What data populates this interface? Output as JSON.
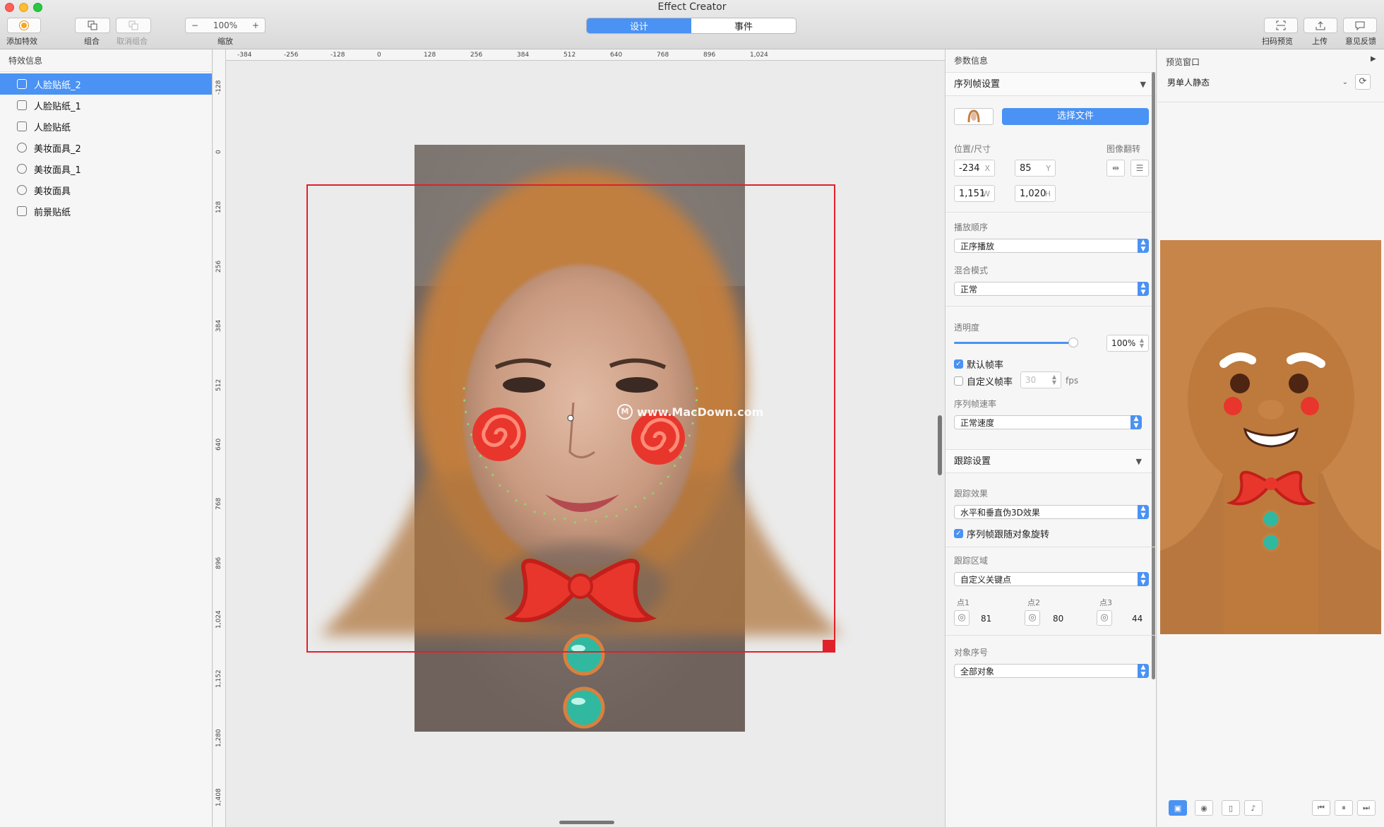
{
  "window": {
    "title": "Effect Creator"
  },
  "toolbar": {
    "add_effect": "添加特效",
    "group": "组合",
    "ungroup": "取消组合",
    "zoom_value": "100%",
    "zoom_minus": "−",
    "zoom_plus": "+",
    "zoom_label": "缩放",
    "tabs": [
      {
        "label": "设计",
        "active": true
      },
      {
        "label": "事件",
        "active": false
      }
    ],
    "scan_preview": "扫码预览",
    "upload": "上传",
    "feedback": "意见反馈"
  },
  "layers": {
    "header": "特效信息",
    "items": [
      {
        "label": "人脸贴纸_2",
        "selected": true,
        "icon": "sticker-icon"
      },
      {
        "label": "人脸贴纸_1",
        "selected": false,
        "icon": "sticker-icon"
      },
      {
        "label": "人脸贴纸",
        "selected": false,
        "icon": "sticker-icon"
      },
      {
        "label": "美妆面具_2",
        "selected": false,
        "icon": "mask-icon"
      },
      {
        "label": "美妆面具_1",
        "selected": false,
        "icon": "mask-icon"
      },
      {
        "label": "美妆面具",
        "selected": false,
        "icon": "mask-icon"
      },
      {
        "label": "前景贴纸",
        "selected": false,
        "icon": "sticker-icon"
      }
    ]
  },
  "canvas": {
    "ruler_h": [
      "-384",
      "-256",
      "-128",
      "0",
      "128",
      "256",
      "384",
      "512",
      "640",
      "768",
      "896",
      "1,024"
    ],
    "ruler_v": [
      "-128",
      "0",
      "128",
      "256",
      "384",
      "512",
      "640",
      "768",
      "896",
      "1,024",
      "1,152",
      "1,280",
      "1,408"
    ],
    "watermark": "www.MacDown.com"
  },
  "params": {
    "header": "参数信息",
    "sequence_section": "序列帧设置",
    "choose_file": "选择文件",
    "pos_size_label": "位置/尺寸",
    "flip_label": "图像翻转",
    "x": "-234",
    "x_suffix": "X",
    "y": "85",
    "y_suffix": "Y",
    "w": "1,151",
    "w_suffix": "W",
    "h": "1,020",
    "h_suffix": "H",
    "play_order_label": "播放顺序",
    "play_order": "正序播放",
    "blend_label": "混合模式",
    "blend": "正常",
    "opacity_label": "透明度",
    "opacity_value": "100%",
    "opacity_level": 1.0,
    "default_fps_label": "默认帧率",
    "default_fps_checked": true,
    "custom_fps_label": "自定义帧率",
    "custom_fps_checked": false,
    "custom_fps_value": "30",
    "fps_unit": "fps",
    "speed_label": "序列帧速率",
    "speed": "正常速度",
    "tracking_section": "跟踪设置",
    "track_effect_label": "跟踪效果",
    "track_effect": "水平和垂直伪3D效果",
    "follow_rotation_label": "序列帧跟随对象旋转",
    "follow_rotation_checked": true,
    "track_region_label": "跟踪区域",
    "track_region": "自定义关键点",
    "points": [
      {
        "label": "点1",
        "value": "81"
      },
      {
        "label": "点2",
        "value": "80"
      },
      {
        "label": "点3",
        "value": "44"
      }
    ],
    "object_index_label": "对象序号",
    "object_index": "全部对象"
  },
  "preview": {
    "header": "预览窗口",
    "model": "男单人静态"
  }
}
